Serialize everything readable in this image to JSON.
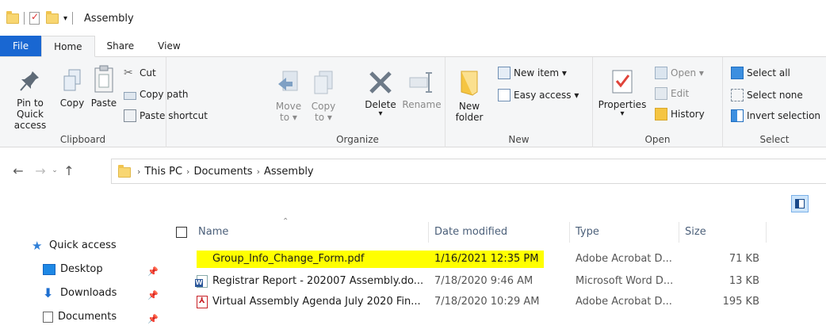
{
  "window": {
    "title": "Assembly"
  },
  "tabs": [
    {
      "label": "File"
    },
    {
      "label": "Home"
    },
    {
      "label": "Share"
    },
    {
      "label": "View"
    }
  ],
  "ribbon": {
    "clipboard": {
      "label": "Clipboard",
      "pin_to_quick_access_line1": "Pin to Quick",
      "pin_to_quick_access_line2": "access",
      "copy": "Copy",
      "paste": "Paste",
      "cut": "Cut",
      "copy_path": "Copy path",
      "paste_shortcut": "Paste shortcut"
    },
    "organize": {
      "label": "Organize",
      "move_to_line1": "Move",
      "move_to_line2": "to ▾",
      "copy_to_line1": "Copy",
      "copy_to_line2": "to ▾",
      "delete": "Delete",
      "delete_arrow": "▾",
      "rename": "Rename"
    },
    "new": {
      "label": "New",
      "new_folder_line1": "New",
      "new_folder_line2": "folder",
      "new_item": "New item ▾",
      "easy_access": "Easy access ▾"
    },
    "open": {
      "label": "Open",
      "properties": "Properties",
      "properties_arrow": "▾",
      "open": "Open ▾",
      "edit": "Edit",
      "history": "History"
    },
    "select": {
      "label": "Select",
      "select_all": "Select all",
      "select_none": "Select none",
      "invert_selection": "Invert selection"
    }
  },
  "address": {
    "crumbs": [
      "This PC",
      "Documents",
      "Assembly"
    ],
    "separator": "›"
  },
  "nav": {
    "back": "←",
    "forward": "→",
    "recent": "⌄",
    "up": "↑"
  },
  "navpane": {
    "items": [
      {
        "label": "Quick access",
        "icon": "star-icon",
        "color": "#2f7fd8"
      },
      {
        "label": "Desktop",
        "icon": "desktop-icon",
        "color": "#1e88e5"
      },
      {
        "label": "Downloads",
        "icon": "download-icon",
        "color": "#1e6fd0"
      },
      {
        "label": "Documents",
        "icon": "documents-icon",
        "color": "#666666"
      }
    ],
    "pin_glyph": "📌"
  },
  "filelist": {
    "headers": {
      "name": "Name",
      "date": "Date modified",
      "type": "Type",
      "size": "Size"
    },
    "rows": [
      {
        "name": "Group_Info_Change_Form.pdf",
        "date": "1/16/2021 12:35 PM",
        "type": "Adobe Acrobat D...",
        "size": "71 KB",
        "icon": "pdf-icon",
        "highlighted": true
      },
      {
        "name": "Registrar Report - 202007 Assembly.do...",
        "date": "7/18/2020 9:46 AM",
        "type": "Microsoft Word D...",
        "size": "13 KB",
        "icon": "word-doc-icon",
        "highlighted": false
      },
      {
        "name": "Virtual Assembly Agenda July 2020 Fin...",
        "date": "7/18/2020 10:29 AM",
        "type": "Adobe Acrobat D...",
        "size": "195 KB",
        "icon": "pdf-icon",
        "highlighted": false
      }
    ]
  },
  "colors": {
    "accent": "#1967d2",
    "highlight": "#ffff00",
    "header_text": "#4c607a"
  }
}
